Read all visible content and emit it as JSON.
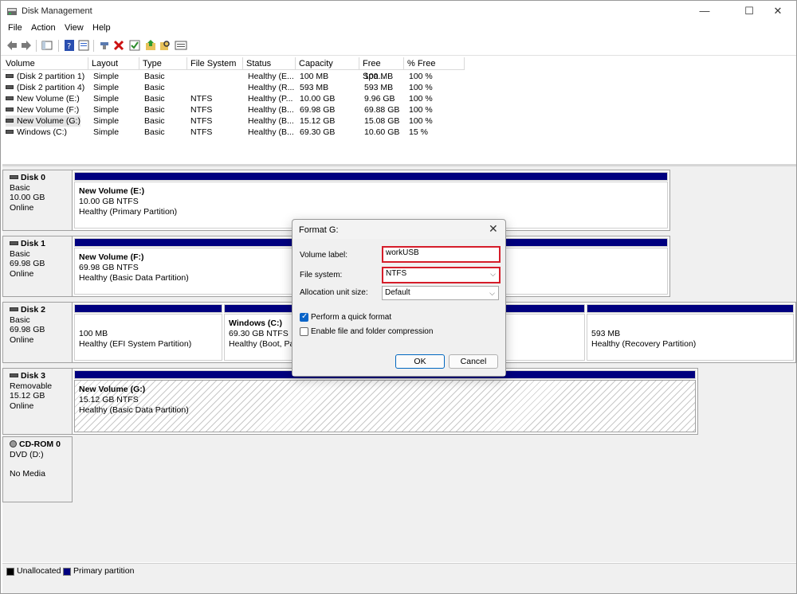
{
  "window": {
    "title": "Disk Management",
    "minimize": "—",
    "maximize": "☐",
    "close": "✕"
  },
  "menu": [
    "File",
    "Action",
    "View",
    "Help"
  ],
  "toolbar_icons": [
    "back-arrow-icon",
    "forward-arrow-icon",
    "console-tree-icon",
    "help-icon",
    "properties-icon",
    "connect-icon",
    "delete-icon",
    "check-icon",
    "up-folder-icon",
    "search-icon",
    "list-icon"
  ],
  "volumes": {
    "columns": [
      "Volume",
      "Layout",
      "Type",
      "File System",
      "Status",
      "Capacity",
      "Free Spa...",
      "% Free"
    ],
    "rows": [
      [
        "(Disk 2 partition 1)",
        "Simple",
        "Basic",
        "",
        "Healthy (E...",
        "100 MB",
        "100 MB",
        "100 %"
      ],
      [
        "(Disk 2 partition 4)",
        "Simple",
        "Basic",
        "",
        "Healthy (R...",
        "593 MB",
        "593 MB",
        "100 %"
      ],
      [
        "New Volume (E:)",
        "Simple",
        "Basic",
        "NTFS",
        "Healthy (P...",
        "10.00 GB",
        "9.96 GB",
        "100 %"
      ],
      [
        "New Volume (F:)",
        "Simple",
        "Basic",
        "NTFS",
        "Healthy (B...",
        "69.98 GB",
        "69.88 GB",
        "100 %"
      ],
      [
        "New Volume (G:)",
        "Simple",
        "Basic",
        "NTFS",
        "Healthy (B...",
        "15.12 GB",
        "15.08 GB",
        "100 %"
      ],
      [
        "Windows (C:)",
        "Simple",
        "Basic",
        "NTFS",
        "Healthy (B...",
        "69.30 GB",
        "10.60 GB",
        "15 %"
      ]
    ]
  },
  "disks": [
    {
      "name": "Disk 0",
      "type": "Basic",
      "size": "10.00 GB",
      "state": "Online",
      "partitions": [
        {
          "title": "New Volume  (E:)",
          "size": "10.00 GB NTFS",
          "status": "Healthy (Primary Partition)"
        }
      ]
    },
    {
      "name": "Disk 1",
      "type": "Basic",
      "size": "69.98 GB",
      "state": "Online",
      "partitions": [
        {
          "title": "New Volume  (F:)",
          "size": "69.98 GB NTFS",
          "status": "Healthy (Basic Data Partition)"
        }
      ]
    },
    {
      "name": "Disk 2",
      "type": "Basic",
      "size": "69.98 GB",
      "state": "Online",
      "partitions": [
        {
          "title": "",
          "size": "100 MB",
          "status": "Healthy (EFI System Partition)"
        },
        {
          "title": "Windows  (C:)",
          "size": "69.30 GB NTFS",
          "status": "Healthy (Boot, Pag"
        },
        {
          "title": "",
          "size": "593 MB",
          "status": "Healthy (Recovery Partition)"
        }
      ]
    },
    {
      "name": "Disk 3",
      "type": "Removable",
      "size": "15.12 GB",
      "state": "Online",
      "partitions": [
        {
          "title": "New Volume  (G:)",
          "size": "15.12 GB NTFS",
          "status": "Healthy (Basic Data Partition)"
        }
      ]
    },
    {
      "name": "CD-ROM 0",
      "type": "DVD (D:)",
      "size": "",
      "state": "No Media",
      "partitions": []
    }
  ],
  "legend": [
    {
      "label": "Unallocated",
      "color": "#000000"
    },
    {
      "label": "Primary partition",
      "color": "#00007f"
    }
  ],
  "dialog": {
    "title": "Format G:",
    "close": "✕",
    "volume_label_label": "Volume label:",
    "volume_label_value": "workUSB",
    "file_system_label": "File system:",
    "file_system_value": "NTFS",
    "allocation_label": "Allocation unit size:",
    "allocation_value": "Default",
    "quick_format_label": "Perform a quick format",
    "quick_format_checked": true,
    "compression_label": "Enable file and folder compression",
    "compression_checked": false,
    "ok_label": "OK",
    "cancel_label": "Cancel",
    "highlight_color": "#d51d2a"
  }
}
